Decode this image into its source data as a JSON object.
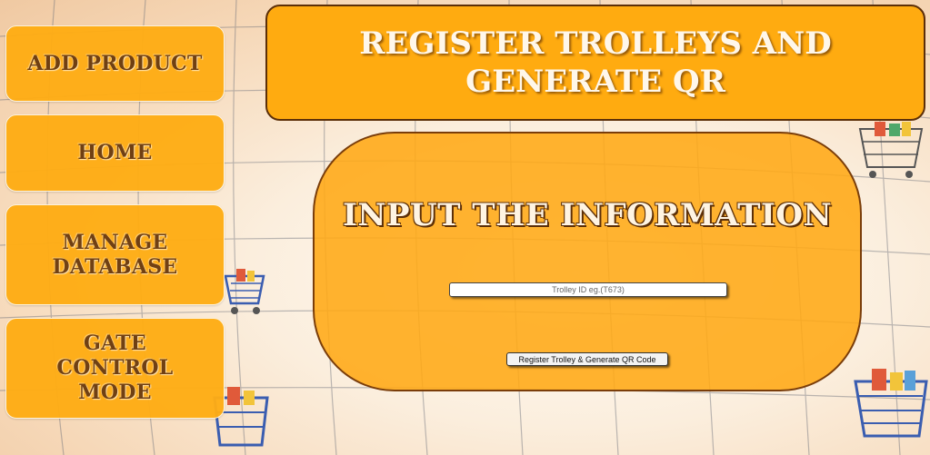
{
  "sidebar": {
    "items": [
      {
        "label": "ADD PRODUCT"
      },
      {
        "label": "HOME"
      },
      {
        "label": "MANAGE DATABASE"
      },
      {
        "label": "GATE CONTROL MODE"
      }
    ]
  },
  "header": {
    "title": "REGISTER TROLLEYS AND GENERATE QR"
  },
  "form": {
    "heading": "INPUT THE INFORMATION",
    "trolley_id_placeholder": "Trolley ID eg.(T673)",
    "submit_label": "Register Trolley & Generate QR Code"
  },
  "colors": {
    "accent": "#ffab10",
    "border": "#5c2f08",
    "text_dark": "#6b3a0c"
  },
  "decorations": {
    "background_icon": "shopping-cart-icon"
  }
}
